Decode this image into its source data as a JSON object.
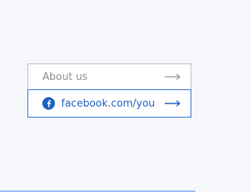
{
  "links": {
    "about_label": "About us",
    "facebook_label": "facebook.com/you"
  },
  "icons": {
    "about_arrow": "arrow-right-icon",
    "facebook": "facebook-icon",
    "facebook_arrow": "arrow-right-icon"
  },
  "colors": {
    "background": "#f5f7fa",
    "border_default": "#b7bcc4",
    "accent": "#2f6fd6",
    "text_muted": "#8d9196"
  }
}
